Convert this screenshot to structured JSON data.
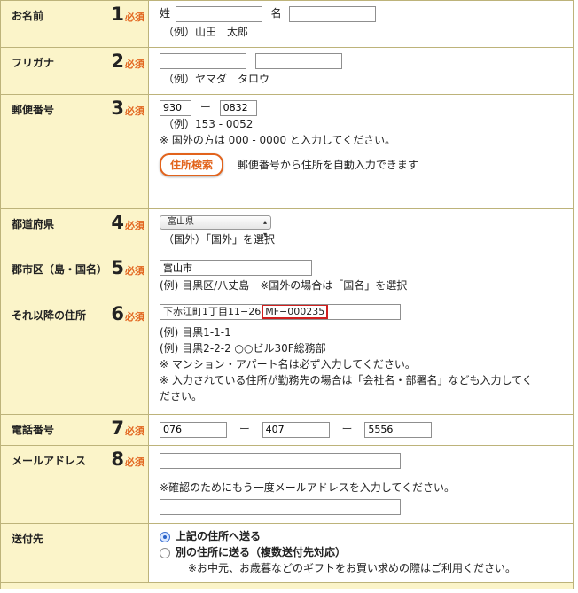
{
  "fields": {
    "name": {
      "label": "お名前",
      "num": "1",
      "required": "必須",
      "sei_label": "姓",
      "mei_label": "名",
      "sei_value": "",
      "mei_value": "",
      "example": "（例）山田　太郎"
    },
    "furigana": {
      "label": "フリガナ",
      "num": "2",
      "required": "必須",
      "value1": "",
      "value2": "",
      "example": "（例）ヤマダ　タロウ"
    },
    "postal": {
      "label": "郵便番号",
      "num": "3",
      "required": "必須",
      "value1": "930",
      "separator": "ー",
      "value2": "0832",
      "example": "（例）153 - 0052",
      "note": "※ 国外の方は 000 - 0000 と入力してください。",
      "search_button": "住所検索",
      "search_hint": "郵便番号から住所を自動入力できます"
    },
    "prefecture": {
      "label": "都道府県",
      "num": "4",
      "required": "必須",
      "selected": "富山県",
      "note": "（国外）「国外」を選択"
    },
    "city": {
      "label": "郡市区（島・国名）",
      "num": "5",
      "required": "必須",
      "value": "富山市",
      "example": "(例) 目黒区/八丈島　※国外の場合は「国名」を選択"
    },
    "address": {
      "label": "それ以降の住所",
      "num": "6",
      "required": "必須",
      "value": "下赤江町1丁目11−26",
      "value_highlight": "MF−000235",
      "example1": "(例) 目黒1-1-1",
      "example2": "(例) 目黒2-2-2 ○○ビル30F総務部",
      "note1": "※ マンション・アパート名は必ず入力してください。",
      "note2a": "※ 入力されている住所が勤務先の場合は「会社名・部署名」なども入力してく",
      "note2b": "ださい。"
    },
    "phone": {
      "label": "電話番号",
      "num": "7",
      "required": "必須",
      "value1": "076",
      "value2": "407",
      "value3": "5556",
      "separator": "ー"
    },
    "email": {
      "label": "メールアドレス",
      "num": "8",
      "required": "必須",
      "value": "",
      "confirm_note": "※確認のためにもう一度メールアドレスを入力してください。",
      "confirm_value": ""
    },
    "shipping": {
      "label": "送付先",
      "option1": "上記の住所へ送る",
      "option2": "別の住所に送る（複数送付先対応）",
      "note": "※お中元、お歳暮などのギフトをお買い求めの際はご利用ください。",
      "selected": "option1"
    }
  },
  "colors": {
    "label_bg": "#fbf4c9",
    "border": "#bdb37a",
    "accent": "#e2631c",
    "highlight": "#d02020"
  }
}
